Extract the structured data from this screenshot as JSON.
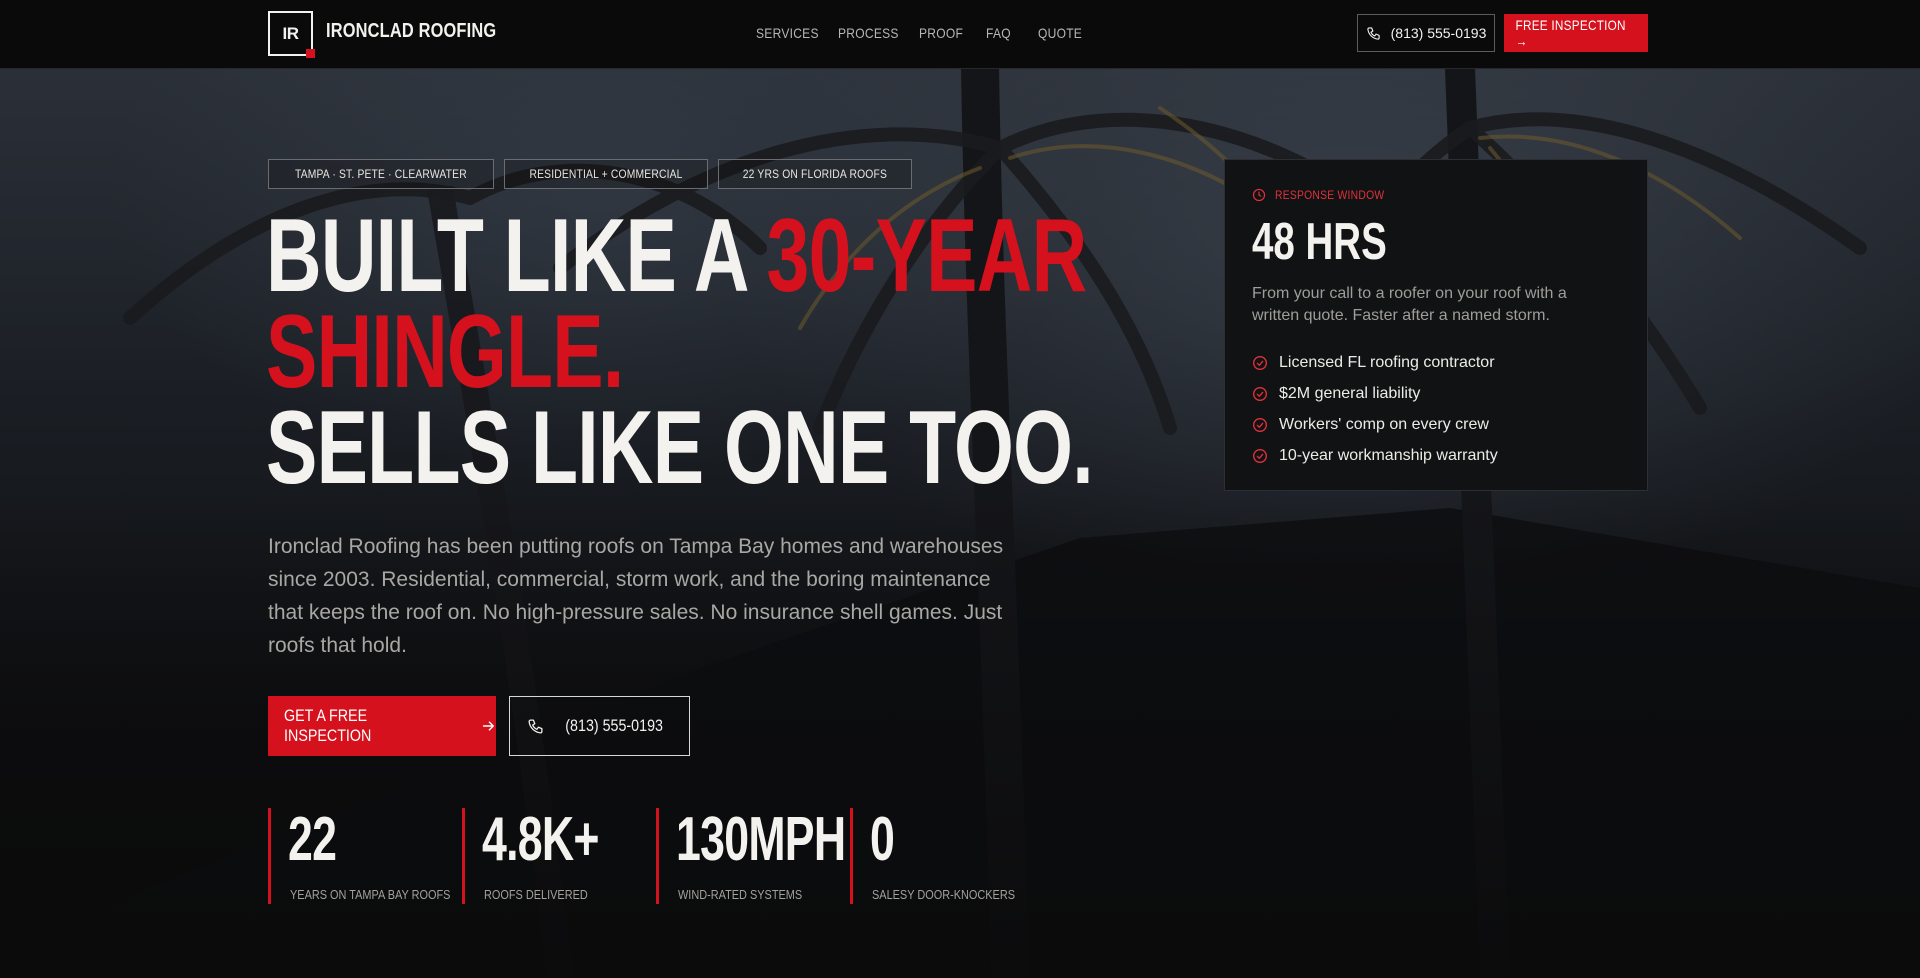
{
  "nav": {
    "logo_mark": "IR",
    "brand": "IRONCLAD ROOFING",
    "links": [
      "SERVICES",
      "PROCESS",
      "PROOF",
      "FAQ",
      "QUOTE"
    ],
    "phone": "(813) 555-0193",
    "cta": "FREE INSPECTION →"
  },
  "hero": {
    "tags": [
      "TAMPA · ST. PETE · CLEARWATER",
      "RESIDENTIAL + COMMERCIAL",
      "22 YRS ON FLORIDA ROOFS"
    ],
    "headline": {
      "line1_a": "BUILT LIKE A ",
      "line1_b": "30-YEAR",
      "line2": "SHINGLE.",
      "line3": "SELLS LIKE ONE TOO."
    },
    "lead": "Ironclad Roofing has been putting roofs on Tampa Bay homes and warehouses since 2003. Residential, commercial, storm work, and the boring maintenance that keeps the roof on. No high-pressure sales. No insurance shell games. Just roofs that hold.",
    "primary_cta": "GET A FREE INSPECTION",
    "secondary_cta": "(813) 555-0193",
    "stats": [
      {
        "value": "22",
        "label": "YEARS ON TAMPA BAY ROOFS"
      },
      {
        "value": "4.8K+",
        "label": "ROOFS DELIVERED"
      },
      {
        "value": "130MPH",
        "label": "WIND-RATED SYSTEMS"
      },
      {
        "value": "0",
        "label": "SALESY DOOR-KNOCKERS"
      }
    ]
  },
  "card": {
    "eyebrow": "RESPONSE WINDOW",
    "value": "48 HRS",
    "description": "From your call to a roofer on your roof with a written quote. Faster after a named storm.",
    "checks": [
      "Licensed FL roofing contractor",
      "$2M general liability",
      "Workers' comp on every crew",
      "10-year workmanship warranty"
    ]
  },
  "colors": {
    "accent": "#d5111d",
    "background": "#0b0b0c",
    "text": "#f4f2ee",
    "muted": "#a9a7a3"
  },
  "icons": {
    "phone": "phone-icon",
    "arrow": "arrow-right-icon",
    "clock": "clock-icon",
    "check": "check-circle-icon"
  }
}
